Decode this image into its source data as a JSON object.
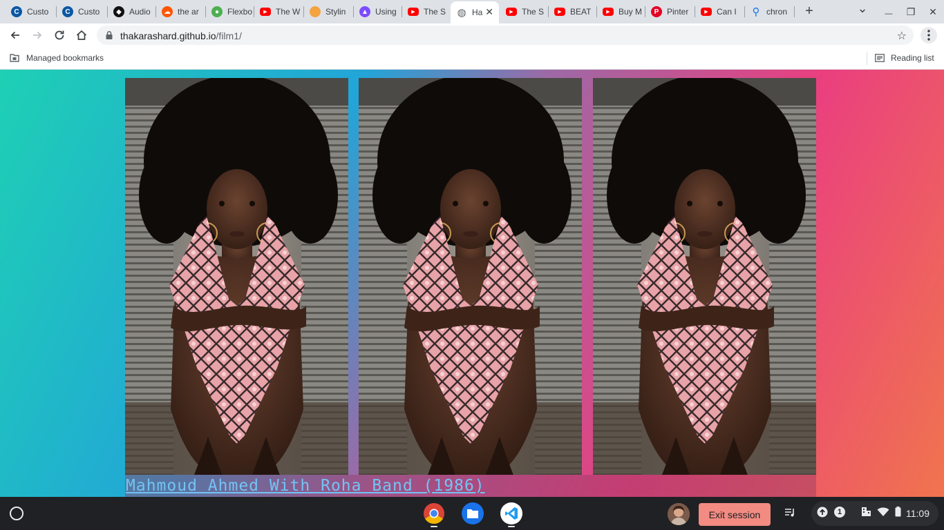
{
  "browser": {
    "tabs": [
      {
        "title": "Custo",
        "icon": "circle-c-icon",
        "color": "#0b57a4"
      },
      {
        "title": "Custo",
        "icon": "circle-c-icon",
        "color": "#0b57a4"
      },
      {
        "title": "Audio",
        "icon": "codepen-icon",
        "color": "#111111"
      },
      {
        "title": "the ar",
        "icon": "soundcloud-icon",
        "color": "#ff5500"
      },
      {
        "title": "Flexbo",
        "icon": "frog-icon",
        "color": "#4caf50"
      },
      {
        "title": "The W",
        "icon": "youtube-icon",
        "color": "#ff0000"
      },
      {
        "title": "Stylin",
        "icon": "orange-dot-icon",
        "color": "#f4a340"
      },
      {
        "title": "Using",
        "icon": "rocket-icon",
        "color": "#7c4dff"
      },
      {
        "title": "The S",
        "icon": "youtube-icon",
        "color": "#ff0000"
      },
      {
        "title": "Ha",
        "icon": "globe-icon",
        "color": "#5f6368",
        "active": true
      },
      {
        "title": "The S",
        "icon": "youtube-icon",
        "color": "#ff0000"
      },
      {
        "title": "BEAT",
        "icon": "youtube-icon",
        "color": "#ff0000"
      },
      {
        "title": "Buy M",
        "icon": "youtube-icon",
        "color": "#ff0000"
      },
      {
        "title": "Pinter",
        "icon": "pinterest-icon",
        "color": "#e60023"
      },
      {
        "title": "Can I",
        "icon": "youtube-icon",
        "color": "#ff0000"
      },
      {
        "title": "chron",
        "icon": "search-icon",
        "color": "#1a73e8"
      }
    ],
    "url_host": "thakarashard.github.io",
    "url_path": "/film1/",
    "bookmarks": {
      "managed": "Managed bookmarks",
      "reading_list": "Reading list"
    }
  },
  "page": {
    "caption": "Mahmoud Ahmed With Roha Band (1986)",
    "photos": [
      {
        "name": "photo-1"
      },
      {
        "name": "photo-2"
      },
      {
        "name": "photo-3"
      }
    ],
    "colors": {
      "gradient_start": "#1ed0b4",
      "gradient_mid": "#ea3f7f",
      "gradient_end": "#f0744e",
      "link": "#72c4f5"
    }
  },
  "shelf": {
    "apps": [
      {
        "name": "chrome-app-icon"
      },
      {
        "name": "files-app-icon"
      },
      {
        "name": "vscode-app-icon"
      }
    ],
    "exit_label": "Exit session",
    "notification_count": "1",
    "time": "11:09"
  }
}
